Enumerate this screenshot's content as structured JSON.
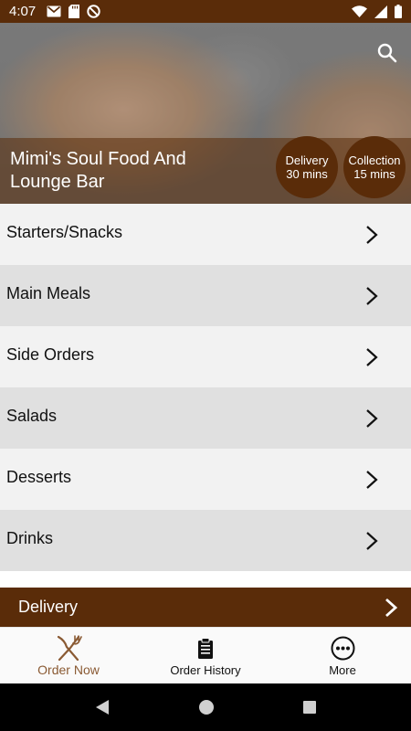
{
  "status_bar": {
    "time": "4:07"
  },
  "header": {
    "restaurant_name": "Mimi's Soul Food And Lounge Bar",
    "delivery": {
      "label": "Delivery",
      "time": "30 mins"
    },
    "collection": {
      "label": "Collection",
      "time": "15 mins"
    }
  },
  "menu": {
    "categories": [
      {
        "label": "Starters/Snacks"
      },
      {
        "label": "Main Meals"
      },
      {
        "label": "Side Orders"
      },
      {
        "label": "Salads"
      },
      {
        "label": "Desserts"
      },
      {
        "label": "Drinks"
      }
    ]
  },
  "order_mode_bar": {
    "label": "Delivery"
  },
  "bottom_nav": {
    "items": [
      {
        "label": "Order Now",
        "icon": "fork-knife-icon",
        "active": true
      },
      {
        "label": "Order History",
        "icon": "clipboard-icon",
        "active": false
      },
      {
        "label": "More",
        "icon": "more-dots-icon",
        "active": false
      }
    ]
  },
  "colors": {
    "brand_brown": "#5a2c09",
    "active_nav": "#8a5a33",
    "row_light": "#f2f2f2",
    "row_dark": "#e0e0e0"
  }
}
